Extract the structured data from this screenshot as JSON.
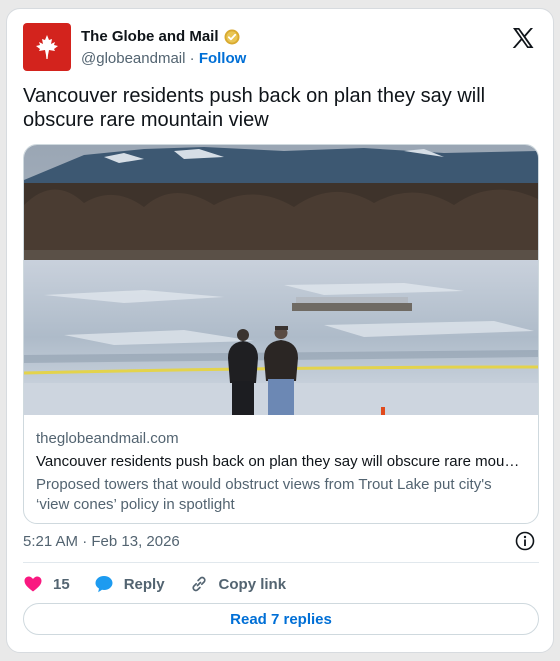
{
  "account": {
    "name": "The Globe and Mail",
    "handle": "@globeandmail",
    "separator": "·",
    "follow_label": "Follow"
  },
  "tweet": {
    "text": "Vancouver residents push back on plan they say will obscure rare mountain view"
  },
  "link_card": {
    "domain": "theglobeandmail.com",
    "title": "Vancouver residents push back on plan they say will obscure rare mountain view",
    "description": "Proposed towers that would obstruct views from Trout Lake put city's ‘view cones’ policy in spotlight"
  },
  "timestamp": "5:21 AM · Feb 13, 2026",
  "actions": {
    "like_count": "15",
    "reply_label": "Reply",
    "copy_label": "Copy link",
    "read_replies_label": "Read 7 replies"
  },
  "icons": {
    "logo": "maple-leaf-icon",
    "verified": "verified-badge-icon",
    "platform": "x-logo-icon",
    "info": "info-icon",
    "like": "heart-icon",
    "reply": "speech-bubble-icon",
    "copy": "link-icon"
  },
  "colors": {
    "brand_red": "#d3231d",
    "link_blue": "#006fd6",
    "like_pink": "#f91880",
    "reply_blue": "#1d9bf0",
    "muted_text": "#536471"
  }
}
